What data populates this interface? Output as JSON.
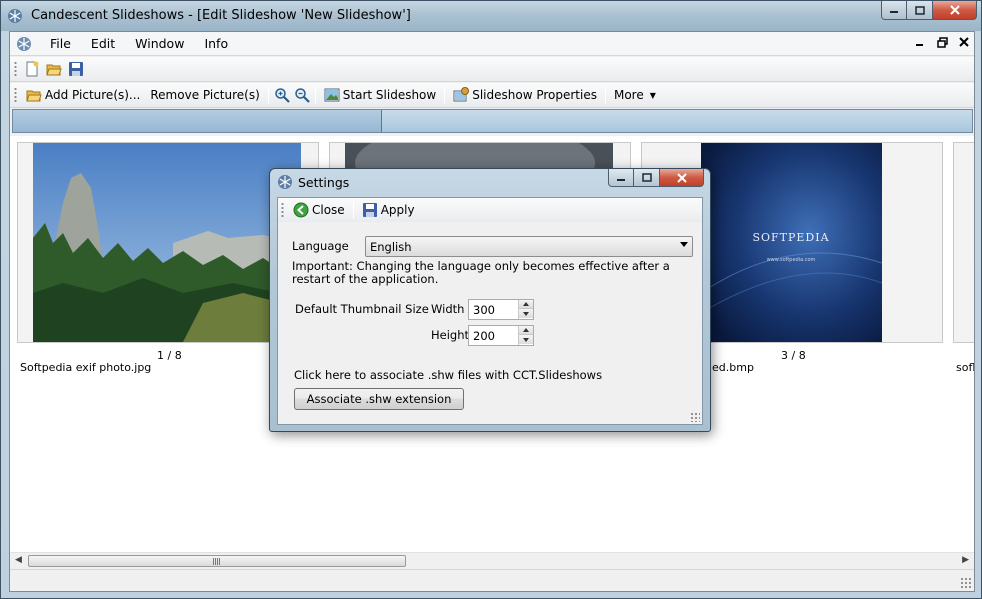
{
  "window": {
    "title": "Candescent Slideshows - [Edit Slideshow 'New Slideshow']"
  },
  "menu": {
    "items": [
      "File",
      "Edit",
      "Window",
      "Info"
    ]
  },
  "toolbar": {
    "add_pictures": "Add Picture(s)...",
    "remove_pictures": "Remove Picture(s)",
    "start_slideshow": "Start Slideshow",
    "slideshow_properties": "Slideshow Properties",
    "more": "More"
  },
  "progress": {
    "fraction": 0.385
  },
  "gallery": {
    "items": [
      {
        "counter": "1 / 8",
        "caption": "Softpedia exif photo.jpg"
      },
      {
        "counter": "",
        "caption": ""
      },
      {
        "counter": "3 / 8",
        "caption": "ed.bmp"
      },
      {
        "counter": "",
        "caption": "sofl"
      }
    ],
    "logo_text": "SOFTPEDIA",
    "logo_sub": "www.softpedia.com"
  },
  "dialog": {
    "title": "Settings",
    "close": "Close",
    "apply": "Apply",
    "language_label": "Language",
    "language_value": "English",
    "important_note": "Important: Changing the language only becomes effective after a restart of the application.",
    "thumb_size_label": "Default Thumbnail Size",
    "width_label": "Width",
    "width_value": "300",
    "height_label": "Height",
    "height_value": "200",
    "associate_text": "Click here to associate .shw files with CCT.Slideshows",
    "associate_button": "Associate .shw extension"
  },
  "colors": {
    "progress_fill": "#a6c3da",
    "close_button": "#c94a35",
    "thumb_bg": "#f3f3f3"
  }
}
